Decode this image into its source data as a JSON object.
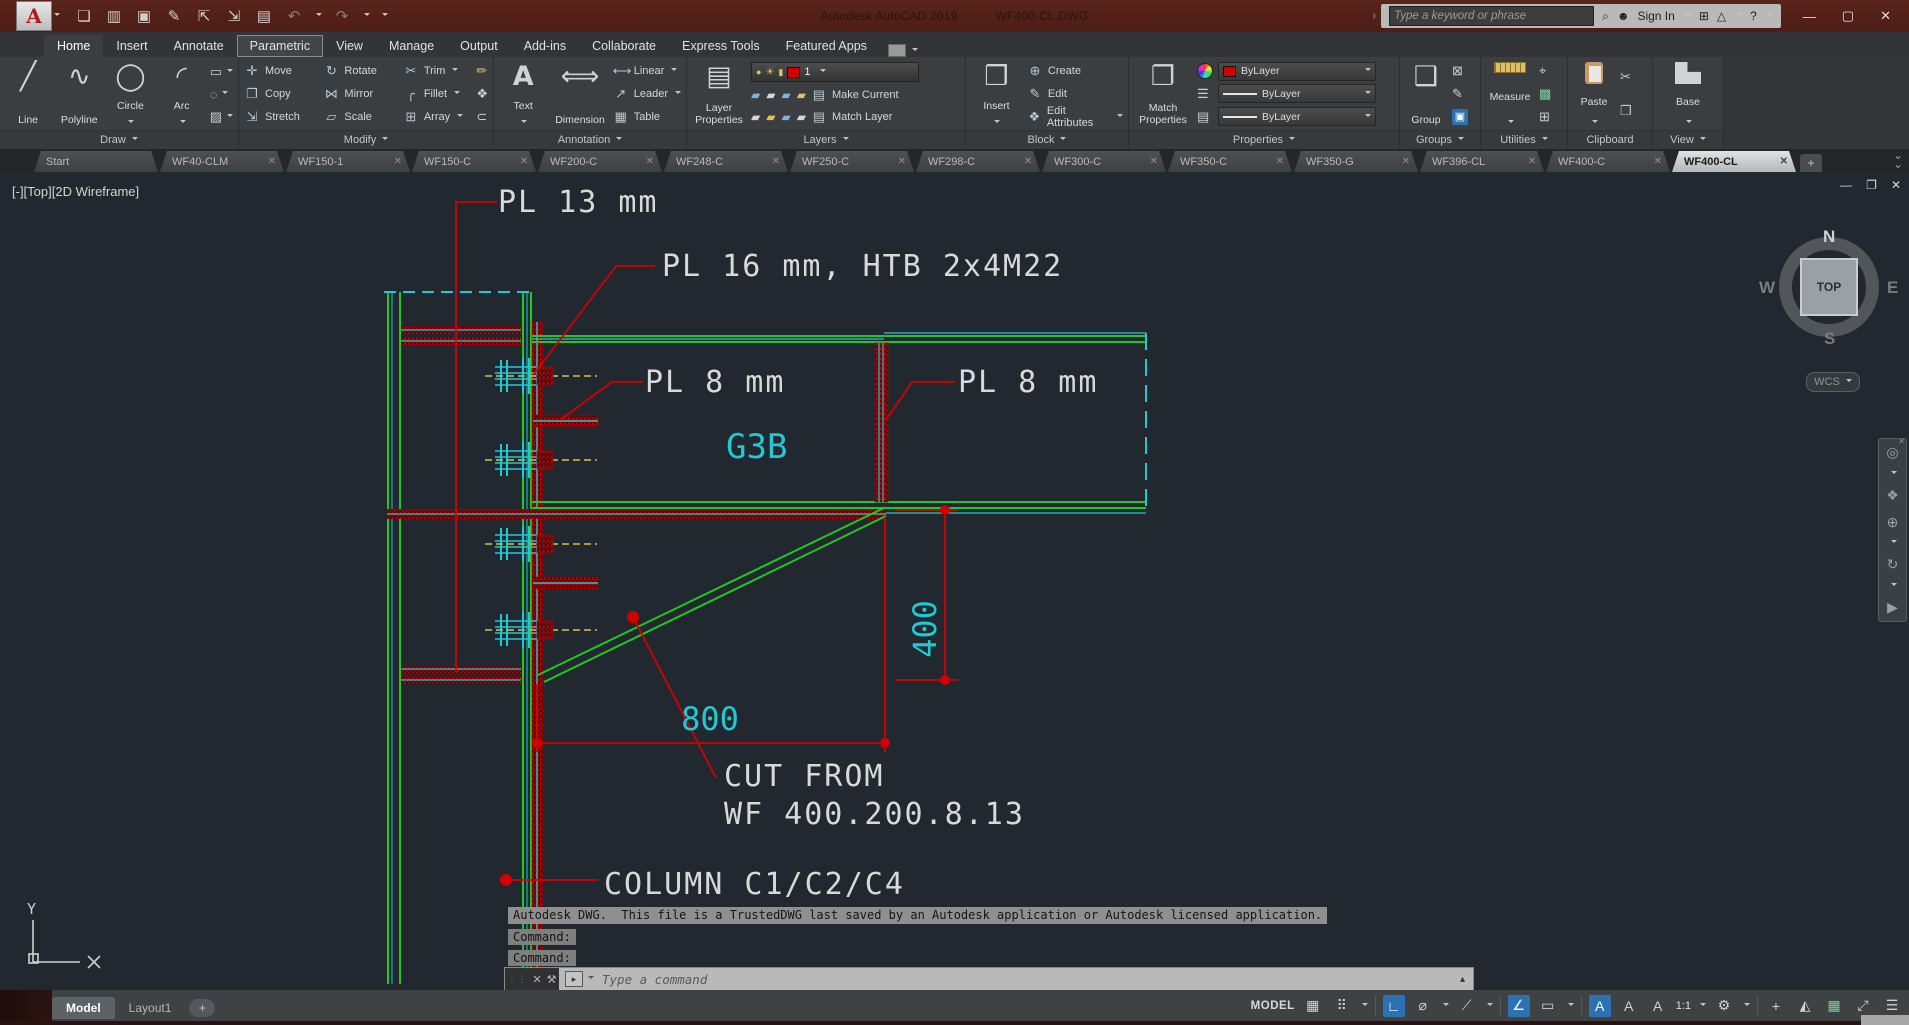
{
  "titlebar": {
    "app": "Autodesk AutoCAD 2019",
    "doc": "WF400-CL.DWG",
    "search_ph": "Type a keyword or phrase",
    "signin": "Sign In"
  },
  "ribbon": {
    "tabs": [
      "Home",
      "Insert",
      "Annotate",
      "Parametric",
      "View",
      "Manage",
      "Output",
      "Add-ins",
      "Collaborate",
      "Express Tools",
      "Featured Apps"
    ],
    "draw": {
      "label": "Draw",
      "line": "Line",
      "polyline": "Polyline",
      "circle": "Circle",
      "arc": "Arc"
    },
    "modify": {
      "label": "Modify",
      "move": "Move",
      "rotate": "Rotate",
      "trim": "Trim",
      "copy": "Copy",
      "mirror": "Mirror",
      "fillet": "Fillet",
      "stretch": "Stretch",
      "scale": "Scale",
      "array": "Array"
    },
    "annotation": {
      "label": "Annotation",
      "text": "Text",
      "dimension": "Dimension",
      "linear": "Linear",
      "leader": "Leader",
      "table": "Table"
    },
    "layers": {
      "label": "Layers",
      "props1": "Layer",
      "props2": "Properties",
      "layer_name": "1",
      "make_current": "Make Current",
      "match_layer": "Match Layer"
    },
    "block": {
      "label": "Block",
      "insert": "Insert",
      "create": "Create",
      "edit": "Edit",
      "edit_attributes": "Edit Attributes"
    },
    "properties": {
      "label": "Properties",
      "match1": "Match",
      "match2": "Properties",
      "bylayer": "ByLayer"
    },
    "groups": {
      "label": "Groups",
      "group": "Group"
    },
    "utilities": {
      "label": "Utilities",
      "measure": "Measure"
    },
    "clipboard": {
      "label": "Clipboard",
      "paste": "Paste"
    },
    "view": {
      "label": "View",
      "base": "Base"
    }
  },
  "ftabs": [
    "Start",
    "WF40-CLM",
    "WF150-1",
    "WF150-C",
    "WF200-C",
    "WF248-C",
    "WF250-C",
    "WF298-C",
    "WF300-C",
    "WF350-C",
    "WF350-G",
    "WF396-CL",
    "WF400-C",
    "WF400-CL"
  ],
  "drawing": {
    "viewport": "[-][Top][2D Wireframe]",
    "pl13": "PL 13 mm",
    "pl16": "PL 16 mm, HTB 2x4M22",
    "pl8_left": "PL 8 mm",
    "pl8_right": "PL 8 mm",
    "beam_mark": "G3B",
    "dim_vert": "400",
    "dim_horiz": "800",
    "cut_from_1": "CUT FROM",
    "cut_from_2": "WF 400.200.8.13",
    "column_mark": "COLUMN C1/C2/C4",
    "ucs_y": "Y"
  },
  "viewcube": {
    "n": "N",
    "e": "E",
    "s": "S",
    "w": "W",
    "top": "TOP",
    "wcs": "WCS"
  },
  "command": {
    "trusted": "Autodesk DWG.  This file is a TrustedDWG last saved by an Autodesk application or Autodesk licensed application.",
    "prompt1": "Command:",
    "prompt2": "Command:",
    "placeholder": "Type a command"
  },
  "status": {
    "model": "Model",
    "layout1": "Layout1",
    "model_space": "MODEL",
    "scale": "1:1"
  },
  "colors": {
    "green": "#21c821",
    "red": "#d40000",
    "cyan": "#22c8d2",
    "yellow": "#d9c34d",
    "titlebar": "#4f1d15",
    "canvas_bg": "#212830"
  },
  "icons": {
    "logo": "A",
    "new": "❏",
    "open": "▥",
    "save": "▣",
    "saveas": "✎",
    "web": "⇱",
    "mobile": "⇲",
    "plot": "▤",
    "undo": "↶",
    "redo": "↷",
    "search": "⌕",
    "user": "☻",
    "cart": "⊞",
    "astore": "△",
    "help": "?",
    "min": "—",
    "max": "▢",
    "close": "✕",
    "restore": "❐",
    "line": "╱",
    "polyline": "∿",
    "circle": "◯",
    "arc": "◜",
    "rect": "▭",
    "ellipse": "◌",
    "hatch": "▨",
    "move": "✛",
    "rotate": "↻",
    "trim": "✂",
    "copy": "❐",
    "mirror": "⋈",
    "fillet": "╭",
    "stretch": "⇲",
    "scale": "▱",
    "array": "⊞",
    "erase": "✏",
    "explode": "❖",
    "offset": "⊂",
    "text": "A",
    "dimension": "⟺",
    "linear": "⟷",
    "leader": "↗",
    "table": "▦",
    "layerprops": "▤",
    "bulb": "●",
    "sun": "☀",
    "lock": "▮",
    "layertool": "▰",
    "insert": "❒",
    "create": "⊕",
    "edit": "✎",
    "editattr": "❖",
    "matchprops": "❐",
    "lines3": "☰",
    "listicon": "▤",
    "group": "❑",
    "ungroup": "⊠",
    "groupsel": "▣",
    "idpoint": "⌖",
    "quickselect": "▩",
    "quickcalc": "⊞",
    "cut": "✂",
    "wheel": "◎",
    "pan": "❖",
    "zoomnav": "⊕",
    "orbit": "↻",
    "play": "▶",
    "wrench": "⚒",
    "promptarrow": "▸",
    "upcaret": "▴",
    "dots": "⋮⋮",
    "x": "✕",
    "chevron": "⌄",
    "grid": "▦",
    "snap": "⠿",
    "ortho": "∟",
    "polar": "⌀",
    "isodraft": "⟋",
    "autosnap": "∠",
    "osnap": "▭",
    "annot1": "A",
    "annot2": "A",
    "annot3": "A",
    "gear": "⚙",
    "plus": "+",
    "isolate": "◭",
    "graphics": "▦",
    "check": "✔",
    "clean": "⤢",
    "hamburger": "☰"
  }
}
